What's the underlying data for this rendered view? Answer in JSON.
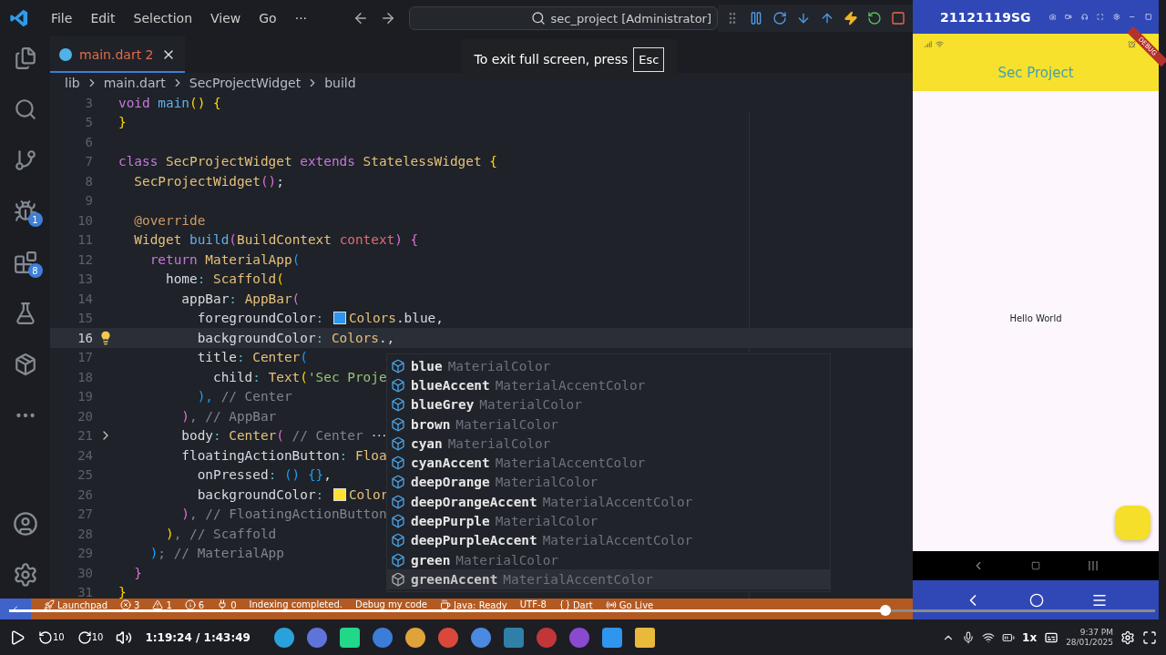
{
  "titlebar": {
    "menus": [
      "File",
      "Edit",
      "Selection",
      "View",
      "Go",
      "···"
    ],
    "search": "sec_project [Administrator]"
  },
  "fullscreen_notice": {
    "text": "To exit full screen, press",
    "key": "Esc"
  },
  "activity_bar": {
    "debug_badge": "1",
    "extensions_badge": "8"
  },
  "tab": {
    "label": "main.dart",
    "problems": "2"
  },
  "breadcrumb": [
    "lib",
    "main.dart",
    "SecProjectWidget",
    "build"
  ],
  "code": [
    {
      "n": "3",
      "selected": false,
      "tokens": [
        {
          "text": "void ",
          "kind": "kw"
        },
        {
          "text": "main",
          "kind": "fn"
        },
        {
          "text": "() {",
          "kind": "b1"
        }
      ]
    },
    {
      "n": "5",
      "selected": false,
      "tokens": [
        {
          "text": "}",
          "kind": "b1"
        }
      ]
    },
    {
      "n": "6",
      "selected": false
    },
    {
      "n": "7",
      "selected": false,
      "tokens": [
        {
          "text": "class ",
          "kind": "kw"
        },
        {
          "text": "SecProjectWidget ",
          "kind": "cls"
        },
        {
          "text": "extends ",
          "kind": "kw"
        },
        {
          "text": "StatelessWidget ",
          "kind": "cls"
        },
        {
          "text": "{",
          "kind": "b1"
        }
      ]
    },
    {
      "n": "8",
      "selected": false,
      "tokens": [
        {
          "text": "  SecProjectWidget",
          "kind": "cls"
        },
        {
          "text": "()",
          "kind": "b2"
        },
        {
          "text": ";",
          "kind": "id"
        }
      ]
    },
    {
      "n": "9",
      "selected": false
    },
    {
      "n": "10",
      "selected": false,
      "tokens": [
        {
          "text": "  @override",
          "kind": "deco"
        }
      ]
    },
    {
      "n": "11",
      "selected": false,
      "tokens": [
        {
          "text": "  Widget ",
          "kind": "cls"
        },
        {
          "text": "build",
          "kind": "fn"
        },
        {
          "text": "(",
          "kind": "b2"
        },
        {
          "text": "BuildContext ",
          "kind": "cls"
        },
        {
          "text": "context",
          "kind": "var"
        },
        {
          "text": ")",
          "kind": "b2"
        },
        {
          "text": " {",
          "kind": "b2"
        }
      ]
    },
    {
      "n": "12",
      "selected": false,
      "tokens": [
        {
          "text": "    return ",
          "kind": "kw"
        },
        {
          "text": "MaterialApp",
          "kind": "cls"
        },
        {
          "text": "(",
          "kind": "b3"
        }
      ]
    },
    {
      "n": "13",
      "selected": false,
      "tokens": [
        {
          "text": "      home",
          "kind": "id"
        },
        {
          "text": ": ",
          "kind": "pun"
        },
        {
          "text": "Scaffold",
          "kind": "cls"
        },
        {
          "text": "(",
          "kind": "b1"
        }
      ]
    },
    {
      "n": "14",
      "selected": false,
      "tokens": [
        {
          "text": "        appBar",
          "kind": "id"
        },
        {
          "text": ": ",
          "kind": "pun"
        },
        {
          "text": "AppBar",
          "kind": "cls"
        },
        {
          "text": "(",
          "kind": "b2"
        }
      ]
    },
    {
      "n": "15",
      "selected": false,
      "tokens": [
        {
          "text": "          foregroundColor",
          "kind": "id"
        },
        {
          "text": ": ",
          "kind": "pun"
        },
        {
          "kind": "swatch",
          "color": "#2f95ee"
        },
        {
          "text": "Colors",
          "kind": "cls"
        },
        {
          "text": ".blue,",
          "kind": "id"
        }
      ]
    },
    {
      "n": "16",
      "selected": true,
      "kind": "lightbulb",
      "tokens": [
        {
          "text": "          backgroundColor",
          "kind": "id"
        },
        {
          "text": ": ",
          "kind": "pun"
        },
        {
          "text": "Colors",
          "kind": "cls"
        },
        {
          "text": ".,",
          "kind": "id"
        }
      ]
    },
    {
      "n": "17",
      "selected": false,
      "tokens": [
        {
          "text": "          title",
          "kind": "id"
        },
        {
          "text": ": ",
          "kind": "pun"
        },
        {
          "text": "Center",
          "kind": "cls"
        },
        {
          "text": "(",
          "kind": "b3"
        }
      ]
    },
    {
      "n": "18",
      "selected": false,
      "tokens": [
        {
          "text": "            child",
          "kind": "id"
        },
        {
          "text": ": ",
          "kind": "pun"
        },
        {
          "text": "Text",
          "kind": "cls"
        },
        {
          "text": "(",
          "kind": "b1"
        },
        {
          "text": "'Sec Proje",
          "kind": "str"
        }
      ]
    },
    {
      "n": "19",
      "selected": false,
      "tokens": [
        {
          "text": "          ),",
          "kind": "b3"
        },
        {
          "text": " // Center",
          "kind": "cm"
        }
      ]
    },
    {
      "n": "20",
      "selected": false,
      "tokens": [
        {
          "text": "        )",
          "kind": "b2"
        },
        {
          "text": ", // AppBar",
          "kind": "cm"
        }
      ]
    },
    {
      "n": "21",
      "selected": false,
      "kind": "fold",
      "tokens": [
        {
          "text": "        body",
          "kind": "id"
        },
        {
          "text": ": ",
          "kind": "pun"
        },
        {
          "text": "Center",
          "kind": "cls"
        },
        {
          "text": "(",
          "kind": "b2"
        },
        {
          "text": " // Center ",
          "kind": "cm"
        },
        {
          "text": "···",
          "kind": "fold"
        }
      ]
    },
    {
      "n": "24",
      "selected": false,
      "tokens": [
        {
          "text": "        floatingActionButton",
          "kind": "id"
        },
        {
          "text": ": ",
          "kind": "pun"
        },
        {
          "text": "Floa",
          "kind": "cls"
        }
      ]
    },
    {
      "n": "25",
      "selected": false,
      "tokens": [
        {
          "text": "          onPressed",
          "kind": "id"
        },
        {
          "text": ": ",
          "kind": "pun"
        },
        {
          "text": "() {}",
          "kind": "b3"
        },
        {
          "text": ",",
          "kind": "id"
        }
      ]
    },
    {
      "n": "26",
      "selected": false,
      "tokens": [
        {
          "text": "          backgroundColor",
          "kind": "id"
        },
        {
          "text": ": ",
          "kind": "pun"
        },
        {
          "kind": "swatch",
          "color": "#ffe033"
        },
        {
          "text": "Color",
          "kind": "cls"
        }
      ]
    },
    {
      "n": "27",
      "selected": false,
      "tokens": [
        {
          "text": "        )",
          "kind": "b2"
        },
        {
          "text": ", // FloatingActionButton",
          "kind": "cm"
        }
      ]
    },
    {
      "n": "28",
      "selected": false,
      "tokens": [
        {
          "text": "      )",
          "kind": "b1"
        },
        {
          "text": ", // Scaffold",
          "kind": "cm"
        }
      ]
    },
    {
      "n": "29",
      "selected": false,
      "tokens": [
        {
          "text": "    )",
          "kind": "b3"
        },
        {
          "text": "; // MaterialApp",
          "kind": "cm"
        }
      ]
    },
    {
      "n": "30",
      "selected": false,
      "tokens": [
        {
          "text": "  }",
          "kind": "b2"
        }
      ]
    },
    {
      "n": "31",
      "selected": false,
      "tokens": [
        {
          "text": "}",
          "kind": "b1"
        }
      ]
    }
  ],
  "suggestions": [
    {
      "label": "blue",
      "type": "MaterialColor",
      "selected": false
    },
    {
      "label": "blueAccent",
      "type": "MaterialAccentColor",
      "selected": false
    },
    {
      "label": "blueGrey",
      "type": "MaterialColor",
      "selected": false
    },
    {
      "label": "brown",
      "type": "MaterialColor",
      "selected": false
    },
    {
      "label": "cyan",
      "type": "MaterialColor",
      "selected": false
    },
    {
      "label": "cyanAccent",
      "type": "MaterialAccentColor",
      "selected": false
    },
    {
      "label": "deepOrange",
      "type": "MaterialColor",
      "selected": false
    },
    {
      "label": "deepOrangeAccent",
      "type": "MaterialAccentColor",
      "selected": false
    },
    {
      "label": "deepPurple",
      "type": "MaterialColor",
      "selected": false
    },
    {
      "label": "deepPurpleAccent",
      "type": "MaterialAccentColor",
      "selected": false
    },
    {
      "label": "green",
      "type": "MaterialColor",
      "selected": false
    },
    {
      "label": "greenAccent",
      "type": "MaterialAccentColor",
      "selected": true
    }
  ],
  "status_bar": [
    {
      "text": "Launchpad",
      "kind": "rocket"
    },
    {
      "text": "3",
      "kind": "error"
    },
    {
      "text": "1",
      "kind": "warning"
    },
    {
      "text": "6",
      "kind": "info"
    },
    {
      "text": "0",
      "kind": "port"
    },
    {
      "text": "Indexing completed.",
      "kind": "plain"
    },
    {
      "text": "Debug my code",
      "kind": "plain"
    },
    {
      "text": "Java: Ready",
      "kind": "java"
    },
    {
      "text": "UTF-8",
      "kind": "plain"
    },
    {
      "text": "Dart",
      "kind": "braces"
    },
    {
      "text": "Go Live",
      "kind": "broadcast"
    }
  ],
  "phone": {
    "device": "21121119SG",
    "debug_banner": "DEBUG",
    "app_title": "Sec Project",
    "body_text": "Hello World"
  },
  "player": {
    "rewind": "10",
    "forward": "10",
    "time": "1:19:24 / 1:43:49",
    "speed": "1x",
    "level": 0.765
  },
  "clock": {
    "time": "9:37 PM",
    "date": "28/01/2025"
  }
}
